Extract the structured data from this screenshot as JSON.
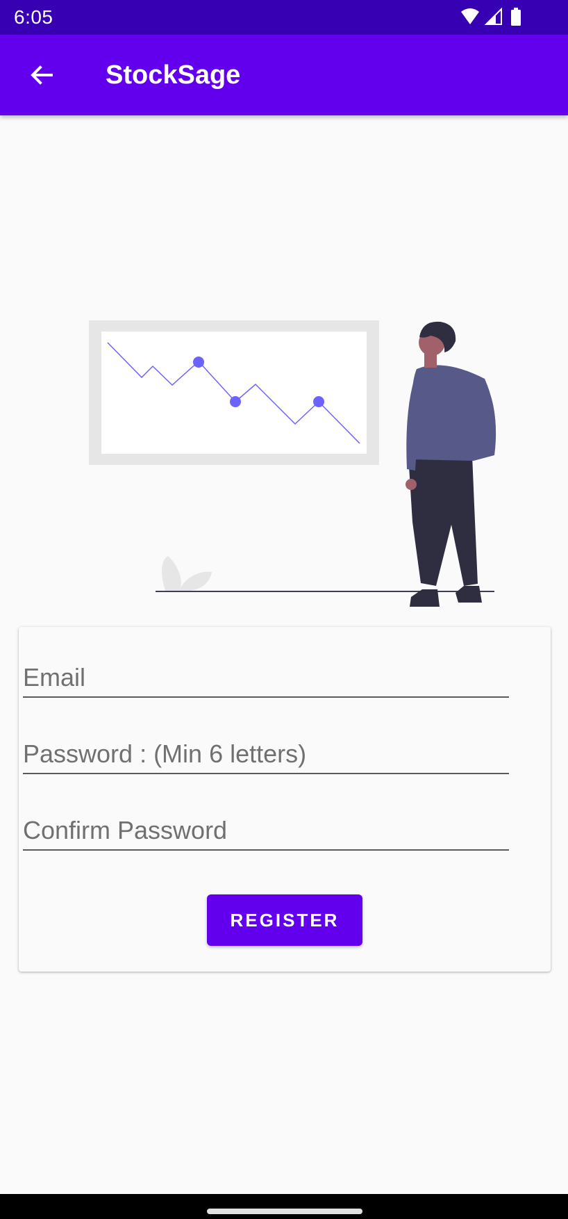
{
  "status_bar": {
    "time": "6:05",
    "icons": [
      "wifi-icon",
      "signal-icon",
      "battery-icon"
    ]
  },
  "app_bar": {
    "title": "StockSage",
    "back_icon": "arrow-back-icon"
  },
  "form": {
    "email_placeholder": "Email",
    "email_value": "",
    "password_placeholder": "Password : (Min 6 letters)",
    "password_value": "",
    "confirm_placeholder": "Confirm Password",
    "confirm_value": "",
    "register_label": "REGISTER"
  },
  "colors": {
    "primary": "#6200ee",
    "primary_dark": "#3700b3",
    "accent_illustration": "#6c63ff"
  }
}
